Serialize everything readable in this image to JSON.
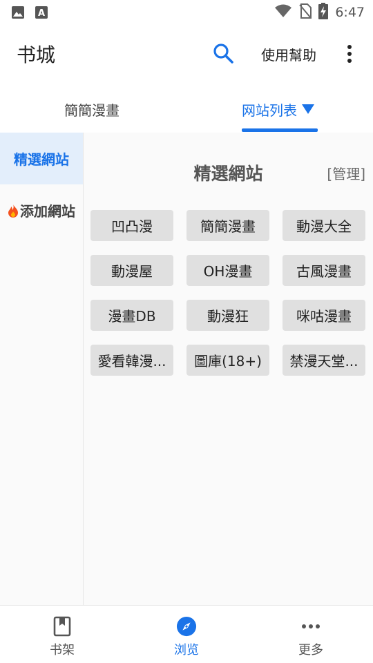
{
  "status_bar": {
    "time": "6:47",
    "icons": [
      "image-icon",
      "text-a-icon",
      "wifi-icon",
      "no-sim-icon",
      "battery-charging-icon"
    ]
  },
  "app_bar": {
    "title": "书城",
    "search_icon": "search-icon",
    "help_label": "使用幫助",
    "more_icon": "more-vert-icon"
  },
  "tabs": [
    {
      "label": "簡簡漫畫",
      "active": false
    },
    {
      "label": "网站列表",
      "active": true,
      "indicator": "▼"
    }
  ],
  "sidebar": {
    "items": [
      {
        "label": "精選網站",
        "active": true
      },
      {
        "label": "添加網站",
        "active": false,
        "icon": "fire-icon"
      }
    ]
  },
  "content": {
    "title": "精選網站",
    "manage_label": "[管理]",
    "sites": [
      {
        "label": "凹凸漫"
      },
      {
        "label": "簡簡漫畫"
      },
      {
        "label": "動漫大全"
      },
      {
        "label": "動漫屋"
      },
      {
        "label": "OH漫畫"
      },
      {
        "label": "古風漫畫"
      },
      {
        "label": "漫畫DB"
      },
      {
        "label": "動漫狂"
      },
      {
        "label": "咪咕漫畫"
      },
      {
        "label": "愛看韓漫..."
      },
      {
        "label": "圖庫(18+)"
      },
      {
        "label": "禁漫天堂..."
      }
    ]
  },
  "bottom_nav": [
    {
      "label": "书架",
      "icon": "bookmark-book-icon",
      "active": false
    },
    {
      "label": "浏览",
      "icon": "compass-icon",
      "active": true
    },
    {
      "label": "更多",
      "icon": "more-horiz-icon",
      "active": false
    }
  ],
  "colors": {
    "accent": "#1a73e8",
    "button_bg": "#e0e0e0",
    "panel_bg": "#fafafa",
    "active_side_bg": "#e3eefb",
    "fire": "#f4511e"
  }
}
